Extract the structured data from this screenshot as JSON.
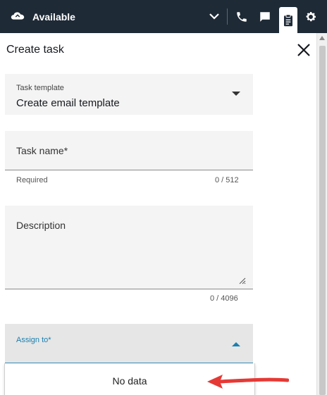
{
  "topbar": {
    "status_label": "Available",
    "icons": [
      "cloud-icon",
      "chevron-down-icon",
      "phone-icon",
      "chat-icon",
      "clipboard-icon",
      "gear-icon"
    ],
    "active_tab": "clipboard-icon",
    "background": "#1e2a36"
  },
  "panel": {
    "title": "Create task",
    "close_icon": "close-icon"
  },
  "form": {
    "template": {
      "label": "Task template",
      "value": "Create email template"
    },
    "task_name": {
      "placeholder": "Task name*",
      "helper": "Required",
      "counter": "0 / 512"
    },
    "description": {
      "placeholder": "Description",
      "counter": "0 / 4096"
    },
    "assign_to": {
      "label": "Assign to*",
      "dropdown_text": "No data",
      "accent": "#1a7fb0"
    }
  },
  "annotation": {
    "arrow_color": "#e53935"
  }
}
